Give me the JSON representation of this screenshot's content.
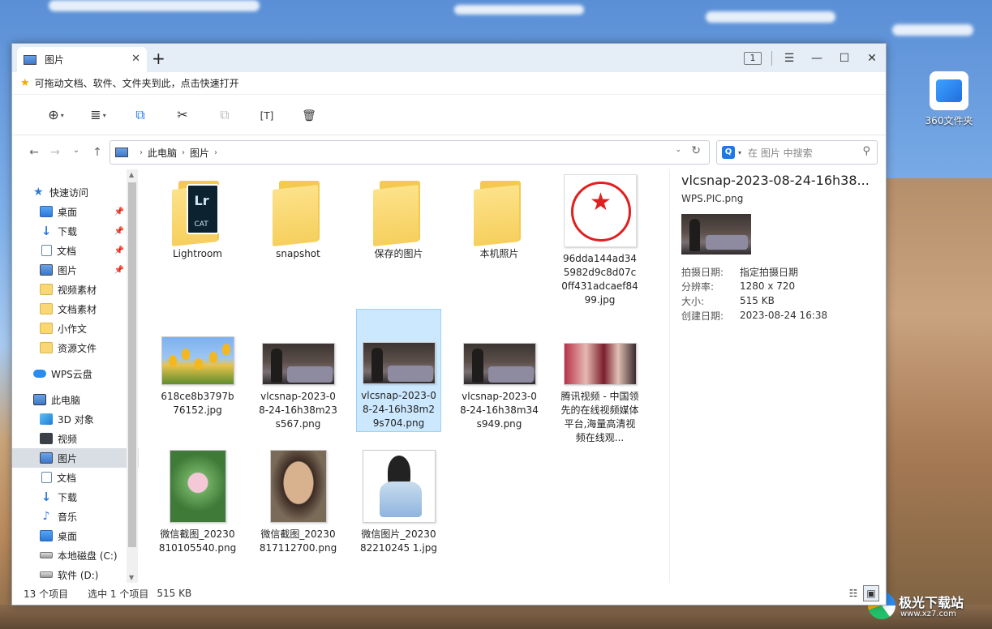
{
  "window": {
    "tab_title": "图片",
    "new_tab": "+",
    "tab_count": "1",
    "controls": {
      "menu": "☰",
      "minimize": "—",
      "maximize": "☐",
      "close": "✕"
    }
  },
  "favbar": {
    "text": "可拖动文档、软件、文件夹到此，点击快速打开"
  },
  "toolbar": {
    "new_icon": "⊕",
    "view_icon": "≣",
    "copy_icon": "⧉",
    "cut_icon": "✂",
    "paste_icon": "⧉",
    "rename_icon": "[T]",
    "delete_icon": "🗑"
  },
  "address": {
    "crumbs": [
      "此电脑",
      "图片"
    ],
    "search_placeholder": "在 图片 中搜索"
  },
  "sidebar": {
    "items": [
      {
        "label": "快速访问"
      },
      {
        "label": "桌面"
      },
      {
        "label": "下载"
      },
      {
        "label": "文档"
      },
      {
        "label": "图片"
      },
      {
        "label": "视频素材"
      },
      {
        "label": "文档素材"
      },
      {
        "label": "小作文"
      },
      {
        "label": "资源文件"
      },
      {
        "label": "WPS云盘"
      },
      {
        "label": "此电脑"
      },
      {
        "label": "3D 对象"
      },
      {
        "label": "视频"
      },
      {
        "label": "图片"
      },
      {
        "label": "文档"
      },
      {
        "label": "下载"
      },
      {
        "label": "音乐"
      },
      {
        "label": "桌面"
      },
      {
        "label": "本地磁盘 (C:)"
      },
      {
        "label": "软件 (D:)"
      }
    ]
  },
  "files": [
    {
      "name": "Lightroom",
      "lr_text": "Lr",
      "cat_text": "CAT"
    },
    {
      "name": "snapshot"
    },
    {
      "name": "保存的图片"
    },
    {
      "name": "本机照片"
    },
    {
      "name": "96dda144ad345982d9c8d07c0ff431adcaef8499.jpg"
    },
    {
      "name": "618ce8b3797b76152.jpg"
    },
    {
      "name": "vlcsnap-2023-08-24-16h38m23s567.png"
    },
    {
      "name": "vlcsnap-2023-08-24-16h38m29s704.png"
    },
    {
      "name": "vlcsnap-2023-08-24-16h38m34s949.png"
    },
    {
      "name": "腾讯视频 - 中国领先的在线视频媒体平台,海量高清视频在线观..."
    },
    {
      "name": "微信截图_20230810105540.png"
    },
    {
      "name": "微信截图_20230817112700.png"
    },
    {
      "name": "微信图片_2023082210245 1.jpg"
    }
  ],
  "preview": {
    "title": "vlcsnap-2023-08-24-16h38...",
    "subtitle": "WPS.PIC.png",
    "props": [
      {
        "k": "拍摄日期:",
        "v": "指定拍摄日期"
      },
      {
        "k": "分辨率:",
        "v": "1280 x 720"
      },
      {
        "k": "大小:",
        "v": "515 KB"
      },
      {
        "k": "创建日期:",
        "v": "2023-08-24 16:38"
      }
    ]
  },
  "status": {
    "count": "13 个项目",
    "selected": "选中 1 个项目",
    "size": "515 KB"
  },
  "desktop": {
    "icon_label": "360文件夹",
    "wm_title": "极光下载站",
    "wm_url": "www.xz7.com"
  }
}
